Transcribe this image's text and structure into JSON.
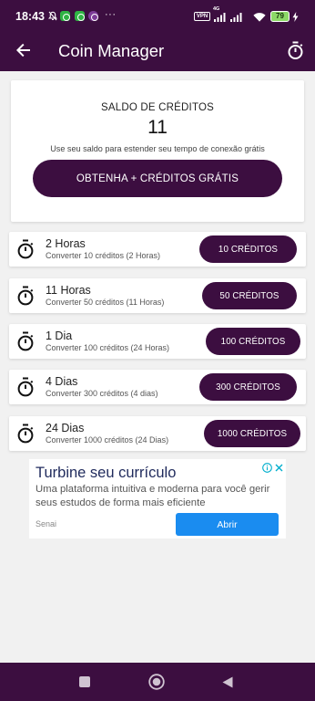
{
  "status_bar": {
    "time": "18:43",
    "overflow_indicator": "···",
    "vpn_label": "VPN",
    "network_type": "4G",
    "battery_level": "79",
    "icons": [
      "notifications-muted-icon",
      "green-app-notification-icon",
      "green-app-notification-icon",
      "purple-app-notification-icon",
      "vpn-icon",
      "signal-icon",
      "signal-icon",
      "wifi-icon",
      "battery-icon",
      "charging-icon"
    ]
  },
  "app_bar": {
    "title": "Coin Manager",
    "back_icon": "back-arrow-icon",
    "action_icon": "stopwatch-icon"
  },
  "balance_card": {
    "heading": "SALDO DE CRÉDITOS",
    "amount": "11",
    "description": "Use seu saldo para estender seu tempo de conexão grátis",
    "cta_label": "OBTENHA + CRÉDITOS GRÁTIS"
  },
  "plans": [
    {
      "icon": "stopwatch-icon",
      "title": "2 Horas",
      "subtitle": "Converter 10 créditos (2 Horas)",
      "button_label": "10 CRÉDITOS"
    },
    {
      "icon": "stopwatch-icon",
      "title": "11 Horas",
      "subtitle": "Converter 50 créditos (11 Horas)",
      "button_label": "50 CRÉDITOS"
    },
    {
      "icon": "stopwatch-icon",
      "title": "1 Dia",
      "subtitle": "Converter 100 créditos (24 Horas)",
      "button_label": "100 CRÉDITOS"
    },
    {
      "icon": "stopwatch-icon",
      "title": "4 Dias",
      "subtitle": "Converter 300 créditos (4 dias)",
      "button_label": "300 CRÉDITOS"
    },
    {
      "icon": "stopwatch-icon",
      "title": "24 Dias",
      "subtitle": "Converter 1000 créditos (24 Dias)",
      "button_label": "1000 CRÉDITOS"
    }
  ],
  "ad": {
    "title": "Turbine seu currículo",
    "body": "Uma plataforma intuitiva e moderna para você gerir seus estudos de forma mais eficiente",
    "advertiser": "Senai",
    "cta_label": "Abrir",
    "icons": [
      "ad-info-icon",
      "ad-close-icon"
    ]
  },
  "nav_bar": {
    "icons": [
      "recent-apps-icon",
      "home-icon",
      "back-triangle-icon"
    ]
  },
  "colors": {
    "primary": "#3c0e40",
    "background": "#f1f1f1",
    "card": "#ffffff",
    "ad_title": "#1f2a5c",
    "ad_button": "#1a8cf0",
    "ad_choices": "#00aecd",
    "battery": "#8cd867",
    "nav_icon": "#cfc3d1"
  }
}
